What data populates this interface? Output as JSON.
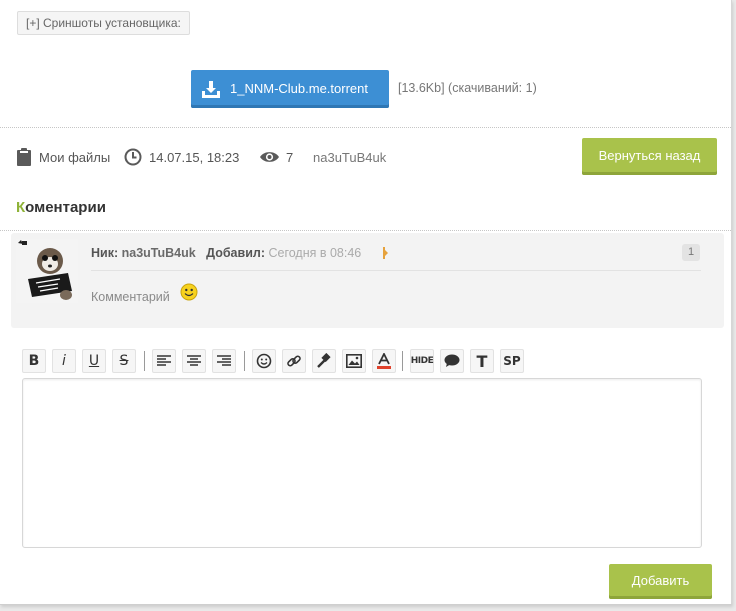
{
  "spoiler": {
    "label": "[+] Сриншоты установщика:"
  },
  "download": {
    "filename": "1_NNM-Club.me.torrent",
    "meta": "[13.6Kb] (скачиваний: 1)"
  },
  "meta": {
    "files_label": "Мои файлы",
    "date": "14.07.15, 18:23",
    "views": "7",
    "author": "na3uTuB4uk",
    "back_label": "Вернуться назад"
  },
  "comments": {
    "heading_first_letter": "К",
    "heading_rest": "оментарии",
    "items": [
      {
        "nick_label": "Ник:",
        "nick": "na3uTuB4uk",
        "added_label": "Добавил:",
        "date": "Сегодня в 08:46",
        "number": "1",
        "text": "Комментарий"
      }
    ]
  },
  "editor": {
    "toolbar": {
      "bold": "B",
      "italic": "i",
      "underline": "U",
      "strike": "S",
      "hide": "HIDE",
      "text": "T",
      "spoiler": "SP"
    },
    "submit_label": "Добавить"
  },
  "colors": {
    "accent_green": "#a9c24b",
    "download_blue": "#3d8fd4",
    "heading_accent": "#8fb339"
  }
}
